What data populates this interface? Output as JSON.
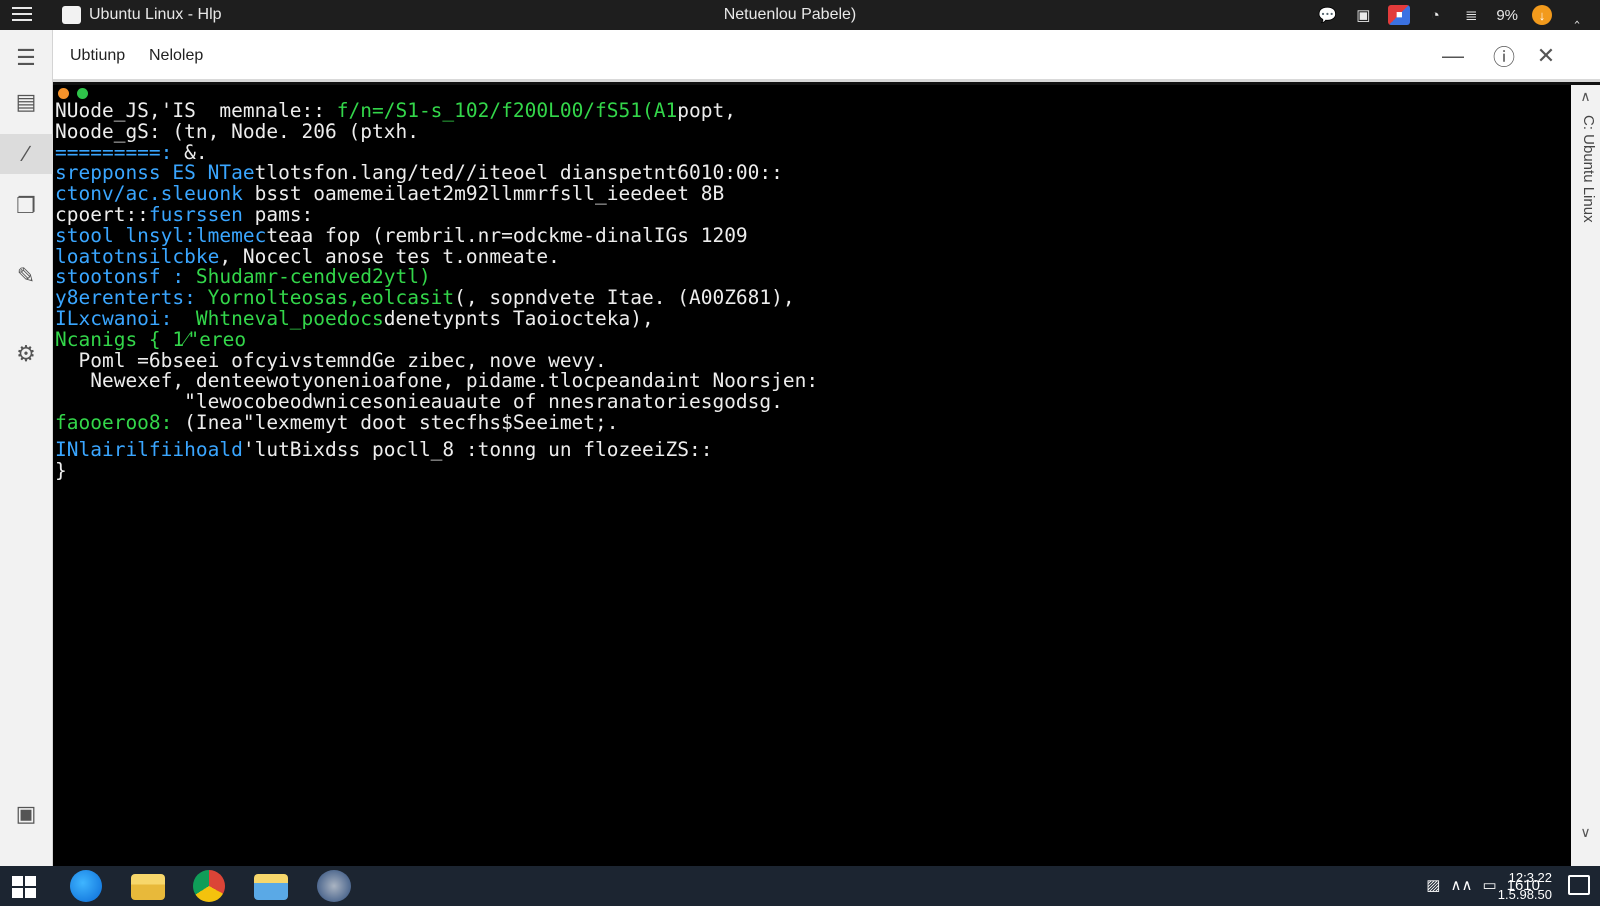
{
  "titlebar": {
    "app_title": "Ubuntu Linux - Hlp",
    "center_title": "Netuenlou Pabele)",
    "battery": "9%",
    "tray_icons": [
      "chat-icon",
      "media-icon",
      "app-icon",
      "clock-icon",
      "message-icon",
      "update-icon",
      "chevron-icon"
    ]
  },
  "window": {
    "tabs": [
      "Ubtiunp",
      "Nelolep"
    ],
    "controls": [
      "minimize-icon",
      "info-icon",
      "close-icon"
    ]
  },
  "sidebar": {
    "icons": [
      "collapse-icon",
      "document-icon",
      "terminal-icon",
      "copy-icon",
      "brush-icon",
      "settings-icon",
      "package-icon"
    ]
  },
  "scrollbar": {
    "vertical_label": "C: Ubuntu Linux"
  },
  "terminal": {
    "lines": [
      {
        "segments": [
          {
            "text": "NUode_JS,'IS  memnale:: ",
            "c": "white"
          },
          {
            "text": "f/n=/S1-s_102/f200L00/fS51(A1",
            "c": "green"
          },
          {
            "text": "popt,",
            "c": "white"
          }
        ]
      },
      {
        "segments": [
          {
            "text": "Noode_gS: (tn, Node. 206 (ptxh.",
            "c": "white"
          }
        ]
      },
      {
        "segments": [
          {
            "text": "=========: ",
            "c": "blue"
          },
          {
            "text": "&.",
            "c": "white"
          }
        ]
      },
      {
        "segments": [
          {
            "text": "srepponss ES NTae",
            "c": "blue"
          },
          {
            "text": "tlotsfon.lang/ted//iteoel dianspetnt6010:00::",
            "c": "white"
          }
        ]
      },
      {
        "segments": [
          {
            "text": "ctonv/ac.sleuonk ",
            "c": "blue"
          },
          {
            "text": "bsst oamemeilaet2m92llmmrfsll_ieedeet 8B",
            "c": "white"
          }
        ]
      },
      {
        "segments": [
          {
            "text": "cpoert::",
            "c": "white"
          },
          {
            "text": "fusrssen ",
            "c": "blue"
          },
          {
            "text": "pams:",
            "c": "white"
          }
        ]
      },
      {
        "segments": [
          {
            "text": "stool lnsyl:lmemec",
            "c": "blue"
          },
          {
            "text": "teaa fop (rembril.nr=odckme-dinalIGs 1209",
            "c": "white"
          }
        ]
      },
      {
        "segments": [
          {
            "text": "loatotnsilcbke",
            "c": "blue"
          },
          {
            "text": ", Nocecl anose tes t.onmeate.",
            "c": "white"
          }
        ]
      },
      {
        "segments": [
          {
            "text": "stootonsf : ",
            "c": "blue"
          },
          {
            "text": "Shudamr-cendved2ytl)",
            "c": "green"
          }
        ]
      },
      {
        "segments": [
          {
            "text": "y8erenterts: ",
            "c": "blue"
          },
          {
            "text": "Yornolteosas,eolcasit",
            "c": "green"
          },
          {
            "text": "(, sopndvete Itae. (A00Z681),",
            "c": "white"
          }
        ]
      },
      {
        "segments": [
          {
            "text": "ILxcwanoi:  ",
            "c": "blue"
          },
          {
            "text": "Whtneval_poedocs",
            "c": "green"
          },
          {
            "text": "denetypnts Taoiocteka),",
            "c": "white"
          }
        ]
      },
      {
        "segments": [
          {
            "text": "Ncanigs { 1⁄\"ereo",
            "c": "green"
          }
        ]
      },
      {
        "segments": [
          {
            "text": "  Poml =6bseei ofcyivstemndGe zibec, nove wevy.",
            "c": "white"
          }
        ]
      },
      {
        "segments": [
          {
            "text": "   Newexef, denteewotyonenioafone, pidame.tlocpeandaint Noorsjen:",
            "c": "white"
          }
        ]
      },
      {
        "segments": [
          {
            "text": "           \"lewocobeodwnicesonieauaute of nnesranatoriesgodsg.",
            "c": "white"
          }
        ]
      },
      {
        "segments": [
          {
            "text": "faooeroo8: ",
            "c": "green"
          },
          {
            "text": "(Inea\"lexmemyt doot stecfhs$Seeimet;.",
            "c": "white"
          }
        ]
      },
      {
        "gap": true,
        "segments": [
          {
            "text": "INlairilfiihoald",
            "c": "blue"
          },
          {
            "text": "'lutBixdss pocll_8 :tonng un flozeeiZS::",
            "c": "white"
          }
        ]
      },
      {
        "segments": [
          {
            "text": "}",
            "c": "white"
          }
        ]
      }
    ]
  },
  "taskbar": {
    "apps": [
      "edge-icon",
      "folder-icon",
      "chrome-icon",
      "file-explorer-icon",
      "settings-globe-icon"
    ],
    "tray_text": "1610",
    "clock_time": "12:3.22",
    "clock_date": "1.5.98.50"
  },
  "colors": {
    "terminal_bg": "#000000",
    "green": "#33d64a",
    "blue": "#3aa6ff",
    "text": "#ededed",
    "dot_orange": "#f5922a",
    "dot_green": "#2fc44a"
  }
}
